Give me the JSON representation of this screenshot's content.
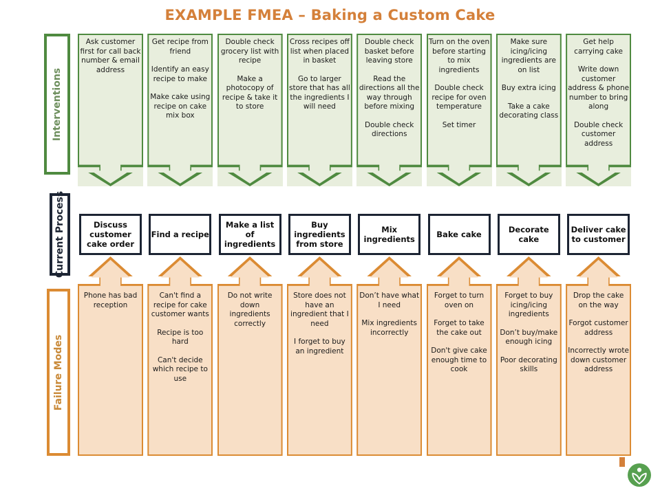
{
  "title": "EXAMPLE FMEA – Baking a Custom Cake",
  "row_labels": {
    "interventions": "Interventions",
    "current_process": "Current Process",
    "failure_modes": "Failure Modes"
  },
  "colors": {
    "title": "#D4803A",
    "intervention_border": "#4F8A40",
    "intervention_fill": "#E8EEDD",
    "process_border": "#1C2433",
    "process_fill": "#FFFFFF",
    "failure_border": "#DB8B33",
    "failure_fill": "#F8DFC6",
    "logo_green": "#57A050"
  },
  "logo": {
    "name": "leaf-sprout-logo"
  },
  "columns": [
    {
      "process": "Discuss customer cake order",
      "interventions": [
        "Ask customer first for call back number & email address"
      ],
      "failure_modes": [
        "Phone has bad reception"
      ]
    },
    {
      "process": "Find a recipe",
      "interventions": [
        "Get recipe from friend",
        "Identify an easy recipe to make",
        "Make cake using recipe on cake mix box"
      ],
      "failure_modes": [
        "Can't find a recipe for cake customer wants",
        "Recipe is too hard",
        "Can't decide which recipe to use"
      ]
    },
    {
      "process": "Make a list of ingredients",
      "interventions": [
        "Double check grocery list with  recipe",
        "Make a photocopy of recipe & take it  to store"
      ],
      "failure_modes": [
        "Do not write down ingredients correctly"
      ]
    },
    {
      "process": "Buy ingredients from store",
      "interventions": [
        "Cross recipes off list when placed in basket",
        "Go to larger store that has all the ingredients I will need"
      ],
      "failure_modes": [
        "Store does not have an ingredient that I need",
        "I forget to buy an ingredient"
      ]
    },
    {
      "process": "Mix ingredients",
      "interventions": [
        "Double check basket before leaving store",
        "Read the directions all the  way through before mixing",
        "Double check directions"
      ],
      "failure_modes": [
        "Don’t have what I need",
        "Mix ingredients incorrectly"
      ]
    },
    {
      "process": "Bake cake",
      "interventions": [
        "Turn on the oven  before starting to mix ingredients",
        "Double check recipe for oven temperature",
        "Set timer"
      ],
      "failure_modes": [
        "Forget to turn oven on",
        "Forget to take the cake out",
        "Don't give cake enough time to cook"
      ]
    },
    {
      "process": "Decorate cake",
      "interventions": [
        "Make sure icing/icing ingredients are on list",
        "Buy extra icing",
        "Take a cake decorating class"
      ],
      "failure_modes": [
        "Forget to buy icing/icing ingredients",
        "Don’t buy/make enough icing",
        "Poor decorating skills"
      ]
    },
    {
      "process": "Deliver cake to customer",
      "interventions": [
        "Get help carrying cake",
        "Write down customer address & phone number to bring along",
        "Double check customer address"
      ],
      "failure_modes": [
        "Drop the cake on the way",
        "Forgot customer address",
        "Incorrectly wrote down customer address"
      ]
    }
  ]
}
